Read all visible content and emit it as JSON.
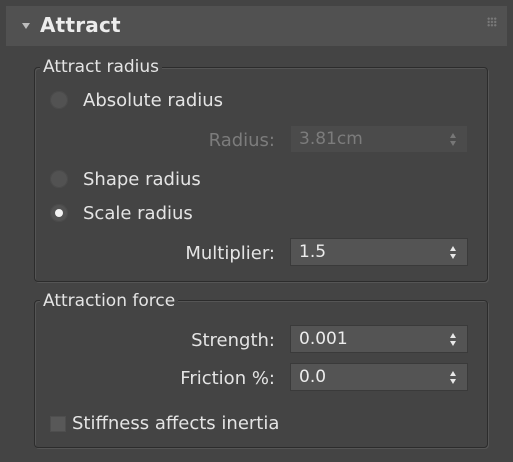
{
  "rollout": {
    "title": "Attract"
  },
  "attract_radius": {
    "group_title": "Attract radius",
    "options": [
      {
        "label": "Absolute radius",
        "checked": false
      },
      {
        "label": "Shape radius",
        "checked": false
      },
      {
        "label": "Scale radius",
        "checked": true
      }
    ],
    "radius_label": "Radius:",
    "radius_value": "3.81cm",
    "multiplier_label": "Multiplier:",
    "multiplier_value": "1.5"
  },
  "attraction_force": {
    "group_title": "Attraction force",
    "strength_label": "Strength:",
    "strength_value": "0.001",
    "friction_label": "Friction %:",
    "friction_value": "0.0",
    "stiffness_label": "Stiffness affects inertia",
    "stiffness_checked": false
  },
  "icons": {
    "collapse": "triangle-down-icon",
    "grip": "drag-grip-icon"
  }
}
